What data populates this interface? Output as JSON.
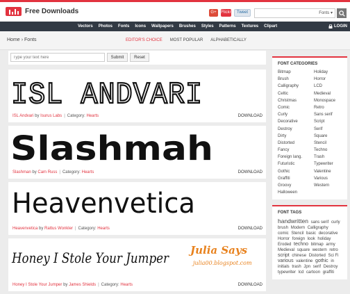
{
  "header": {
    "site_name": "Free Downloads",
    "social": {
      "google": "G+",
      "flickr": "Flickr",
      "twitter": "Tweet"
    },
    "search": {
      "placeholder": "",
      "category": "Fonts"
    }
  },
  "nav": {
    "items": [
      "Vectors",
      "Photos",
      "Fonts",
      "Icons",
      "Wallpapers",
      "Brushes",
      "Styles",
      "Patterns",
      "Textures",
      "Clipart"
    ],
    "login": "LOGIN"
  },
  "breadcrumb": {
    "home": "Home",
    "separator": "›",
    "current": "Fonts"
  },
  "tabs": [
    {
      "label": "EDITOR'S CHOICE",
      "active": true
    },
    {
      "label": "MOST POPULAR",
      "active": false
    },
    {
      "label": "ALPHABETICALLY",
      "active": false
    }
  ],
  "preview_form": {
    "placeholder": "Type your text here",
    "submit": "Submit",
    "reset": "Reset"
  },
  "fonts": [
    {
      "preview": "ISL ANDVARI",
      "name": "ISL Andvari",
      "by": "by",
      "author": "Isurus Labs",
      "category_label": "Category:",
      "category": "Hearts",
      "download": "DOWNLOAD"
    },
    {
      "preview": "Slashmah",
      "name": "Slashman",
      "by": "by",
      "author": "Cam Russ",
      "category_label": "Category:",
      "category": "Hearts",
      "download": "DOWNLOAD"
    },
    {
      "preview": "Heavenvetica",
      "name": "Heavenvetica",
      "by": "by",
      "author": "Rattus Wonkler",
      "category_label": "Category:",
      "category": "Hearts",
      "download": "DOWNLOAD"
    },
    {
      "preview": "Honey I Stole Your Jumper",
      "badge_title": "Julia Says",
      "badge_url": "julia00.blogspot.com",
      "name": "Honey I Stole Your Jumper",
      "by": "by",
      "author": "James Shields",
      "category_label": "Category:",
      "category": "Hearts",
      "download": "DOWNLOAD"
    }
  ],
  "sidebar": {
    "categories_title": "FONT CATEGORIES",
    "categories": [
      "Bitmap",
      "Holiday",
      "Brush",
      "Horror",
      "Calligraphy",
      "LCD",
      "Celtic",
      "Medieval",
      "Christmas",
      "Monospace",
      "Comic",
      "Retro",
      "Curly",
      "Sans serif",
      "Decorative",
      "Script",
      "Destroy",
      "Serif",
      "Dirty",
      "Square",
      "Distorted",
      "Stencil",
      "Fancy",
      "Techno",
      "Foreign lang.",
      "Trash",
      "Futuristic",
      "Typewriter",
      "Gothic",
      "Valentine",
      "Graffiti",
      "Various",
      "Groovy",
      "Western",
      "Halloween",
      ""
    ],
    "tags_title": "FONT TAGS",
    "tags": [
      {
        "t": "handwritten",
        "s": "big"
      },
      {
        "t": "sans serif",
        "s": ""
      },
      {
        "t": "curly",
        "s": ""
      },
      {
        "t": "brush",
        "s": ""
      },
      {
        "t": "Modern",
        "s": ""
      },
      {
        "t": "Calligraphy",
        "s": ""
      },
      {
        "t": "comic",
        "s": ""
      },
      {
        "t": "Stencil",
        "s": ""
      },
      {
        "t": "basic",
        "s": ""
      },
      {
        "t": "decorative",
        "s": ""
      },
      {
        "t": "Horror",
        "s": ""
      },
      {
        "t": "foreign",
        "s": ""
      },
      {
        "t": "look",
        "s": ""
      },
      {
        "t": "holiday",
        "s": ""
      },
      {
        "t": "Eroded",
        "s": ""
      },
      {
        "t": "techno",
        "s": "mid"
      },
      {
        "t": "bitmap",
        "s": ""
      },
      {
        "t": "army",
        "s": ""
      },
      {
        "t": "Medieval",
        "s": ""
      },
      {
        "t": "square",
        "s": ""
      },
      {
        "t": "western",
        "s": ""
      },
      {
        "t": "retro",
        "s": ""
      },
      {
        "t": "script",
        "s": "mid"
      },
      {
        "t": "chinese",
        "s": ""
      },
      {
        "t": "Distorted",
        "s": ""
      },
      {
        "t": "Sci Fi",
        "s": ""
      },
      {
        "t": "various",
        "s": "mid"
      },
      {
        "t": "valentine",
        "s": ""
      },
      {
        "t": "gothic",
        "s": "mid"
      },
      {
        "t": "in",
        "s": ""
      },
      {
        "t": "initials",
        "s": ""
      },
      {
        "t": "trash",
        "s": ""
      },
      {
        "t": "Jpn",
        "s": ""
      },
      {
        "t": "serif",
        "s": ""
      },
      {
        "t": "Destroy",
        "s": ""
      },
      {
        "t": "typewriter",
        "s": ""
      },
      {
        "t": "lcd",
        "s": ""
      },
      {
        "t": "cartoon",
        "s": ""
      },
      {
        "t": "graffiti",
        "s": ""
      }
    ]
  },
  "colors": {
    "accent": "#e2333f",
    "navbar": "#323a44",
    "badge": "#e8821e"
  }
}
